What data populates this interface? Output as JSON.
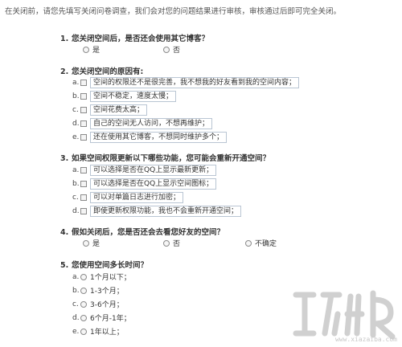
{
  "intro": "在关闭前，请您先填写关闭问卷调查，我们会对您的问题结果进行审核，审核通过后即可完全关闭。",
  "q1": {
    "num": "1.",
    "title": "您关闭空间后，是否还会使用其它博客？",
    "options": [
      "是",
      "否"
    ]
  },
  "q2": {
    "num": "2.",
    "title": "您关闭空间的原因有:",
    "options": [
      {
        "letter": "a.",
        "text": "空间的权限还不是很完善，我不想我的好友看到我的空间内容；"
      },
      {
        "letter": "b.",
        "text": "空间不稳定，速度太慢；"
      },
      {
        "letter": "c.",
        "text": "空间花费太高；"
      },
      {
        "letter": "d.",
        "text": "自己的空间无人访问，不想再维护；"
      },
      {
        "letter": "e.",
        "text": "还在使用其它博客，不想同时维护多个；"
      }
    ]
  },
  "q3": {
    "num": "3.",
    "title": "如果空间权限更新以下哪些功能，您可能会重新开通空间？",
    "options": [
      {
        "letter": "a.",
        "text": "可以选择是否在QQ上显示最新更新；"
      },
      {
        "letter": "b.",
        "text": "可以选择是否在QQ上显示空间图标；"
      },
      {
        "letter": "c.",
        "text": "可以对单篇日志进行加密；"
      },
      {
        "letter": "d.",
        "text": "即使更新权限功能，我也不会重新开通空间；"
      }
    ]
  },
  "q4": {
    "num": "4.",
    "title": "假如关闭后，您是否还会去看您好友的空间？",
    "options": [
      "是",
      "否",
      "不确定"
    ]
  },
  "q5": {
    "num": "5.",
    "title": "您使用空间多长时间？",
    "options": [
      {
        "letter": "a.",
        "text": "1个月以下；"
      },
      {
        "letter": "b.",
        "text": "1-3个月；"
      },
      {
        "letter": "c.",
        "text": "3-6个月；"
      },
      {
        "letter": "d.",
        "text": "6个月-1年；"
      },
      {
        "letter": "e.",
        "text": "1年以上；"
      }
    ]
  },
  "watermark": {
    "site": "www.xiazaiba.com",
    "color": "#c8c8c8"
  }
}
